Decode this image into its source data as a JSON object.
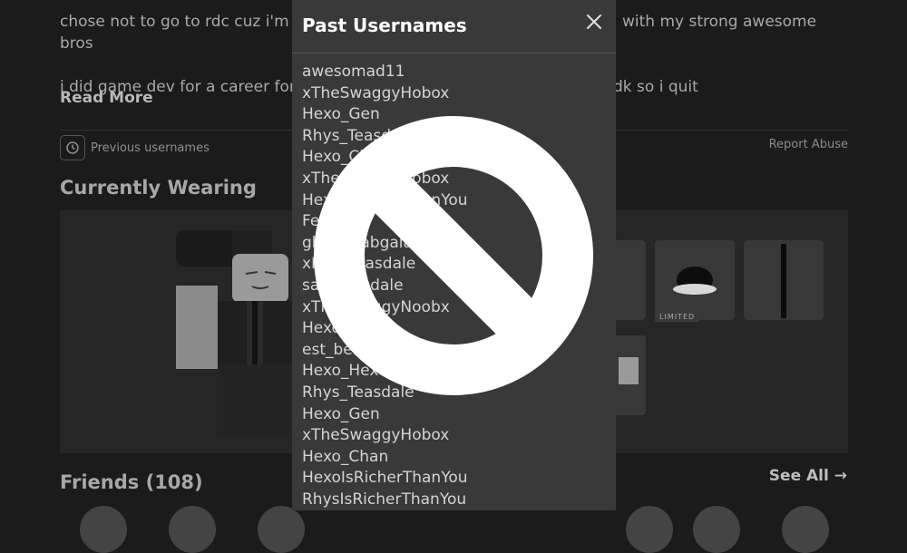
{
  "bio": {
    "line1_left": "chose not to go to rdc cuz i'm t",
    "line1_right": "with my strong awesome",
    "line2": "bros",
    "line3_left": "i did game dev for a career for",
    "line3_right": "dk so i quit",
    "read_more": "Read More"
  },
  "profile_actions": {
    "previous_usernames": "Previous usernames",
    "report_abuse": "Report Abuse"
  },
  "sections": {
    "currently_wearing": "Currently Wearing",
    "friends": "Friends (108)",
    "see_all": "See All →"
  },
  "wearing": {
    "limited_badge": "LIMITED"
  },
  "modal": {
    "title": "Past Usernames",
    "usernames": [
      "awesomad11",
      "xTheSwaggyHobox",
      "Hexo_Gen",
      "Rhys_Teasdale",
      "Hexo_Chan",
      "xTheSwaggyHobox",
      "HexoIsRicherThanYou",
      "Fe",
      "gbgabgabgala",
      "xRhysTeasdale",
      "sallyteasdale",
      "xTheSwaggyNoobx",
      "HexoGen",
      "est_ben",
      "Hexo_Hexo",
      "Rhys_Teasdale",
      "Hexo_Gen",
      "xTheSwaggyHobox",
      "Hexo_Chan",
      "HexoIsRicherThanYou",
      "RhysIsRicherThanYou"
    ]
  },
  "overlay": {
    "icon": "prohibited-icon",
    "color": "#ffffff"
  },
  "colors": {
    "background": "#1b1b1b",
    "modal": "#393939",
    "panel": "#262626"
  }
}
